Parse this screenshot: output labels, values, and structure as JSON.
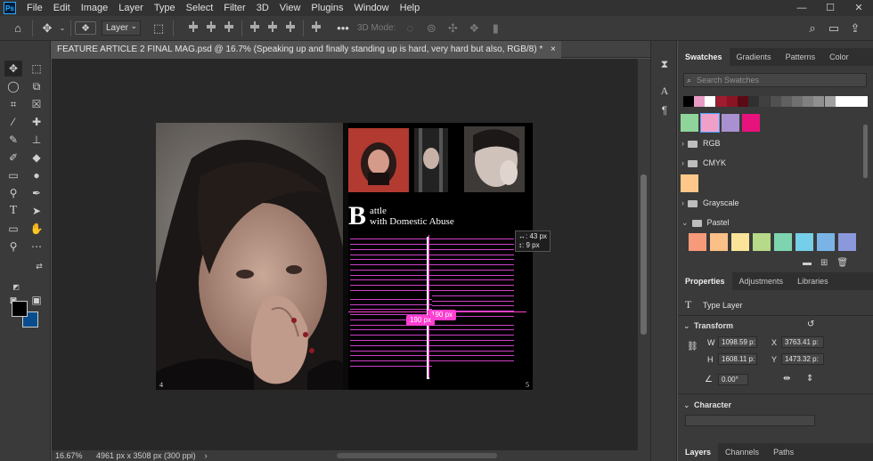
{
  "app": {
    "logo": "Ps"
  },
  "menu": [
    "File",
    "Edit",
    "Image",
    "Layer",
    "Type",
    "Select",
    "Filter",
    "3D",
    "View",
    "Plugins",
    "Window",
    "Help"
  ],
  "window_controls": [
    "—",
    "☐",
    "✕"
  ],
  "options_bar": {
    "auto_select_target": "Layer",
    "mode_3d_label": "3D Mode:"
  },
  "document": {
    "tab_title": "FEATURE ARTICLE 2 FINAL MAG.psd @ 16.7% (Speaking up and finally standing up is hard, very hard but also, RGB/8) *",
    "close": "×",
    "page_left": "4",
    "page_right": "5",
    "dropcap": "B",
    "headline_line1": "attle",
    "headline_line2": "with Domestic Abuse",
    "measure_tip_line1": "↔: 43 px",
    "measure_tip_line2": "↕:  9 px",
    "measure_tag_1": "190 px",
    "measure_tag_2": "190 px"
  },
  "status": {
    "zoom": "16.67%",
    "doc_info": "4961 px x 3508 px (300 ppi)",
    "arrow": "›"
  },
  "swatches_panel": {
    "tabs": [
      "Swatches",
      "Gradients",
      "Patterns",
      "Color"
    ],
    "search_placeholder": "Search Swatches",
    "recent_colors": [
      "#000000",
      "#e89ac4",
      "#ffffff",
      "#a01c2e",
      "#8a1424",
      "#5a0a14",
      "#303030",
      "#404040",
      "#505050",
      "#606060",
      "#707070",
      "#808080",
      "#909090",
      "#a0a0a0",
      "#ffffff",
      "#ffffff",
      "#ffffff"
    ],
    "big_swatches_row1": [
      "#8fd49a",
      "#f0a0c8",
      "#a990d0",
      "#e8127c"
    ],
    "groups": [
      {
        "name": "RGB"
      },
      {
        "name": "CMYK"
      },
      {
        "name": "Grayscale"
      },
      {
        "name": "Pastel"
      }
    ],
    "loose_swatch": "#ffc88a",
    "pastel_colors": [
      "#f79a7a",
      "#fbbf88",
      "#fbe49a",
      "#b6d98a",
      "#7fd4b0",
      "#76cfe8",
      "#7ab4e6",
      "#8b98dc"
    ]
  },
  "properties_panel": {
    "tabs": [
      "Properties",
      "Adjustments",
      "Libraries"
    ],
    "layer_type": "Type Layer",
    "transform_label": "Transform",
    "w_label": "W",
    "w_value": "1098.59 p:",
    "h_label": "H",
    "h_value": "1608.11 p:",
    "x_label": "X",
    "x_value": "3763.41 p:",
    "y_label": "Y",
    "y_value": "1473.32 p:",
    "angle_value": "0.00°",
    "character_label": "Character"
  },
  "layers_panel": {
    "tabs": [
      "Layers",
      "Channels",
      "Paths"
    ]
  }
}
